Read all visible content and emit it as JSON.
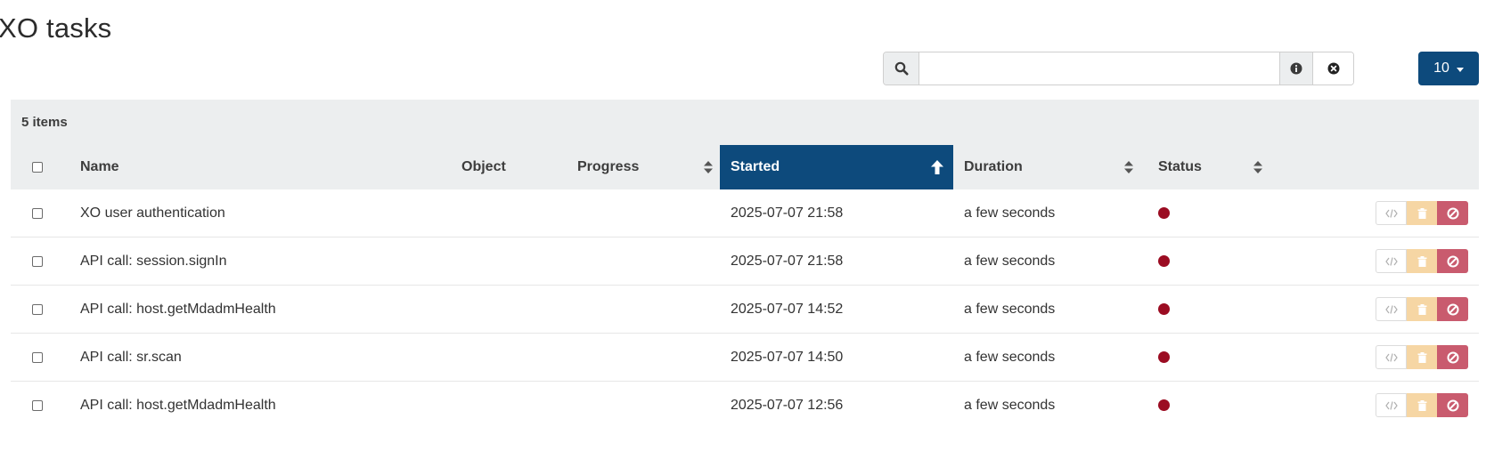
{
  "page": {
    "title": "XO tasks"
  },
  "filter": {
    "value": "",
    "placeholder": ""
  },
  "page_size": {
    "value": "10"
  },
  "table": {
    "item_count": "5 items",
    "columns": {
      "name": "Name",
      "object": "Object",
      "progress": "Progress",
      "started": "Started",
      "duration": "Duration",
      "status": "Status"
    },
    "sorted_column": "Started",
    "sort_direction": "ascending",
    "rows": [
      {
        "name": "XO user authentication",
        "object": "",
        "progress": "",
        "started": "2025-07-07 21:58",
        "duration": "a few seconds",
        "status": "failure"
      },
      {
        "name": "API call: session.signIn",
        "object": "",
        "progress": "",
        "started": "2025-07-07 21:58",
        "duration": "a few seconds",
        "status": "failure"
      },
      {
        "name": "API call: host.getMdadmHealth",
        "object": "",
        "progress": "",
        "started": "2025-07-07 14:52",
        "duration": "a few seconds",
        "status": "failure"
      },
      {
        "name": "API call: sr.scan",
        "object": "",
        "progress": "",
        "started": "2025-07-07 14:50",
        "duration": "a few seconds",
        "status": "failure"
      },
      {
        "name": "API call: host.getMdadmHealth",
        "object": "",
        "progress": "",
        "started": "2025-07-07 12:56",
        "duration": "a few seconds",
        "status": "failure"
      }
    ]
  },
  "icons": {
    "search": "search-icon",
    "info": "info-icon",
    "clear": "clear-icon",
    "sort": "sort-icon",
    "sort_asc": "arrow-up-icon",
    "code": "code-icon",
    "delete": "trash-icon",
    "cancel": "ban-icon"
  },
  "colors": {
    "primary": "#0d4a7c",
    "status_failure": "#9b0c22",
    "warning_light": "#f6d6a4",
    "danger_light": "#c95b6e",
    "header_bg": "#eceeef"
  }
}
